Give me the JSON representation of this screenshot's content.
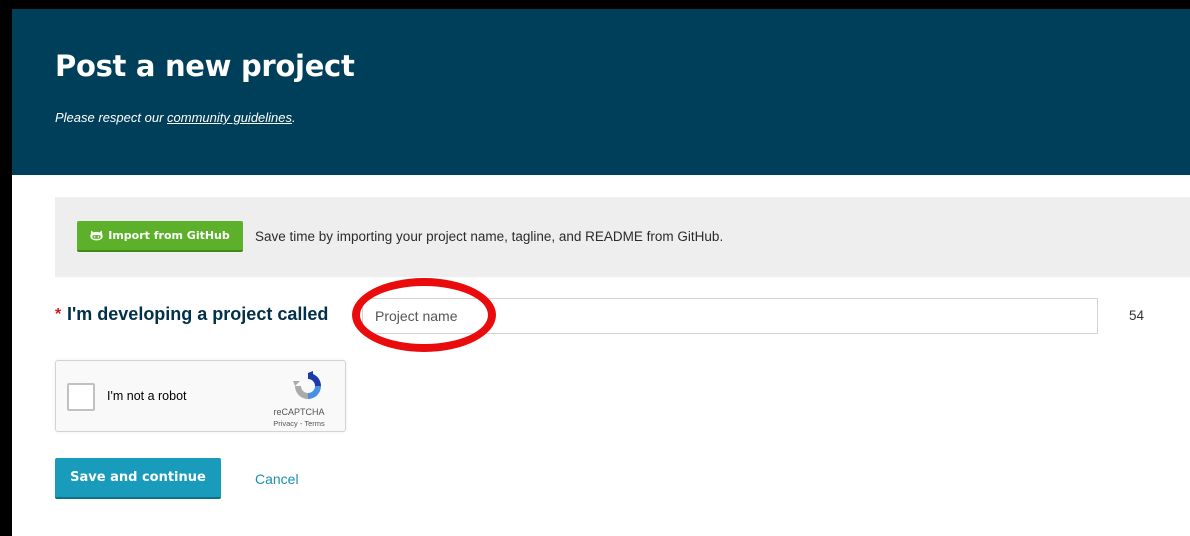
{
  "header": {
    "title": "Post a new project",
    "subtitle_prefix": "Please respect our ",
    "guidelines_link": "community guidelines",
    "subtitle_suffix": "."
  },
  "import_bar": {
    "button_label": "Import from GitHub",
    "button_icon": "github-octocat-icon",
    "description": "Save time by importing your project name, tagline, and README from GitHub."
  },
  "project_field": {
    "required_marker": "*",
    "label": "I'm developing a project called",
    "placeholder": "Project name",
    "value": "",
    "char_count": "54"
  },
  "recaptcha": {
    "checkbox_label": "I'm not a robot",
    "brand": "reCAPTCHA",
    "privacy_link": "Privacy",
    "link_separator": " - ",
    "terms_link": "Terms",
    "icon": "recaptcha-logo-icon"
  },
  "actions": {
    "save_label": "Save and continue",
    "cancel_label": "Cancel"
  },
  "annotation": {
    "shape": "ellipse",
    "target": "project-name-input"
  },
  "colors": {
    "header_bg": "#003f5a",
    "import_button": "#5cb02a",
    "primary_button": "#199cbb",
    "link": "#1a8fb0",
    "required": "#d0161b",
    "annotation": "#ea0c0c"
  }
}
